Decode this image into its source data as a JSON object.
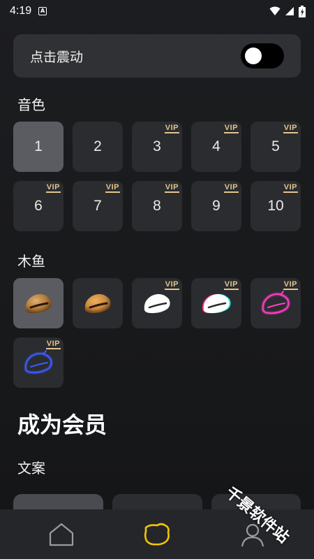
{
  "status_bar": {
    "time": "4:19",
    "app_icon_letter": "A"
  },
  "vibrate": {
    "label": "点击震动",
    "enabled": false
  },
  "timbre": {
    "title": "音色",
    "vip_label": "VIP",
    "items": [
      {
        "label": "1",
        "vip": false,
        "selected": true
      },
      {
        "label": "2",
        "vip": false,
        "selected": false
      },
      {
        "label": "3",
        "vip": true,
        "selected": false
      },
      {
        "label": "4",
        "vip": true,
        "selected": false
      },
      {
        "label": "5",
        "vip": true,
        "selected": false
      },
      {
        "label": "6",
        "vip": true,
        "selected": false
      },
      {
        "label": "7",
        "vip": true,
        "selected": false
      },
      {
        "label": "8",
        "vip": true,
        "selected": false
      },
      {
        "label": "9",
        "vip": true,
        "selected": false
      },
      {
        "label": "10",
        "vip": true,
        "selected": false
      }
    ]
  },
  "muyu": {
    "title": "木鱼",
    "items": [
      {
        "style": "wood",
        "vip": false,
        "selected": true,
        "color": "#b07a3a"
      },
      {
        "style": "wood-gold",
        "vip": false,
        "selected": false,
        "color": "#c8893e"
      },
      {
        "style": "white",
        "vip": true,
        "selected": false,
        "color": "#ffffff"
      },
      {
        "style": "glitch",
        "vip": true,
        "selected": false,
        "color": "#ffffff"
      },
      {
        "style": "neon-pink",
        "vip": true,
        "selected": false,
        "color": "#ff3cc8"
      },
      {
        "style": "neon-blue",
        "vip": true,
        "selected": false,
        "color": "#3a5cff"
      }
    ]
  },
  "member": {
    "title": "成为会员"
  },
  "copy": {
    "title": "文案"
  },
  "nav": {
    "items": [
      {
        "icon": "home-icon",
        "active": false
      },
      {
        "icon": "muyu-icon",
        "active": true
      },
      {
        "icon": "profile-icon",
        "active": false
      }
    ],
    "active_color": "#f5c400"
  },
  "watermark": "千景软件站",
  "colors": {
    "vip_gold": "#e3c48e",
    "tile_bg": "#2b2c2f",
    "tile_selected": "#5b5c61"
  }
}
